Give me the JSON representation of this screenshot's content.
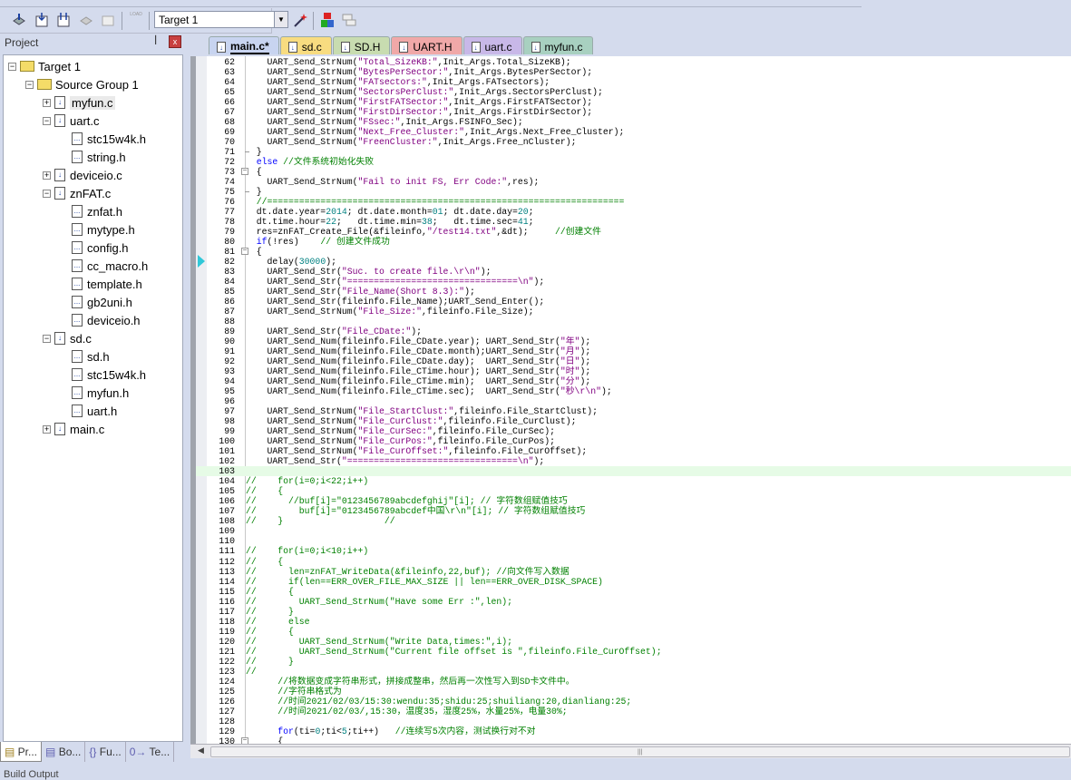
{
  "toolbar": {
    "target_select": "Target 1",
    "icons": [
      "translate-icon",
      "build-icon",
      "rebuild-icon",
      "batch-build-icon",
      "stop-build-icon",
      "download-icon",
      "target-options-icon",
      "manage-components-icon",
      "select-packs-icon"
    ],
    "load_label": "LOAD"
  },
  "project_panel": {
    "title": "Project",
    "tree": [
      {
        "label": "Target 1",
        "depth": 0,
        "kind": "target",
        "expander": "-"
      },
      {
        "label": "Source Group 1",
        "depth": 1,
        "kind": "group",
        "expander": "-"
      },
      {
        "label": "myfun.c",
        "depth": 2,
        "kind": "c",
        "expander": "+",
        "selected": true
      },
      {
        "label": "uart.c",
        "depth": 2,
        "kind": "c",
        "expander": "-"
      },
      {
        "label": "stc15w4k.h",
        "depth": 3,
        "kind": "h"
      },
      {
        "label": "string.h",
        "depth": 3,
        "kind": "h"
      },
      {
        "label": "deviceio.c",
        "depth": 2,
        "kind": "c",
        "expander": "+"
      },
      {
        "label": "znFAT.c",
        "depth": 2,
        "kind": "c",
        "expander": "-"
      },
      {
        "label": "znfat.h",
        "depth": 3,
        "kind": "h"
      },
      {
        "label": "mytype.h",
        "depth": 3,
        "kind": "h"
      },
      {
        "label": "config.h",
        "depth": 3,
        "kind": "h"
      },
      {
        "label": "cc_macro.h",
        "depth": 3,
        "kind": "h"
      },
      {
        "label": "template.h",
        "depth": 3,
        "kind": "h"
      },
      {
        "label": "gb2uni.h",
        "depth": 3,
        "kind": "h"
      },
      {
        "label": "deviceio.h",
        "depth": 3,
        "kind": "h"
      },
      {
        "label": "sd.c",
        "depth": 2,
        "kind": "c",
        "expander": "-"
      },
      {
        "label": "sd.h",
        "depth": 3,
        "kind": "h"
      },
      {
        "label": "stc15w4k.h",
        "depth": 3,
        "kind": "h"
      },
      {
        "label": "myfun.h",
        "depth": 3,
        "kind": "h"
      },
      {
        "label": "uart.h",
        "depth": 3,
        "kind": "h"
      },
      {
        "label": "main.c",
        "depth": 2,
        "kind": "c",
        "expander": "+"
      }
    ],
    "bottom_tabs": [
      {
        "label": "Pr...",
        "icon": "project-icon",
        "active": true
      },
      {
        "label": "Bo...",
        "icon": "books-icon"
      },
      {
        "label": "Fu...",
        "icon": "functions-icon",
        "glyph": "{}"
      },
      {
        "label": "Te...",
        "icon": "templates-icon",
        "glyph": "0→"
      }
    ]
  },
  "build_output_label": "Build Output",
  "editor": {
    "tabs": [
      {
        "label": "main.c*",
        "color": "#c8d4f0",
        "active": true
      },
      {
        "label": "sd.c",
        "color": "#f8dc80"
      },
      {
        "label": "SD.H",
        "color": "#c8dcb0"
      },
      {
        "label": "UART.H",
        "color": "#f0a8a8"
      },
      {
        "label": "uart.c",
        "color": "#c8b8e8"
      },
      {
        "label": "myfun.c",
        "color": "#a8d0c0"
      }
    ],
    "current_line": 82,
    "highlight_line": 103,
    "first_line": 62,
    "fold_open_lines": [
      73,
      81,
      130
    ],
    "fold_end_lines": [
      71,
      75
    ],
    "lines": [
      [
        [
          "p",
          "    UART_Send_StrNum("
        ],
        [
          "s",
          "\"Total_SizeKB:\""
        ],
        [
          "p",
          ",Init_Args.Total_SizeKB);"
        ]
      ],
      [
        [
          "p",
          "    UART_Send_StrNum("
        ],
        [
          "s",
          "\"BytesPerSector:\""
        ],
        [
          "p",
          ",Init_Args.BytesPerSector);"
        ]
      ],
      [
        [
          "p",
          "    UART_Send_StrNum("
        ],
        [
          "s",
          "\"FATsectors:\""
        ],
        [
          "p",
          ",Init_Args.FATsectors);"
        ]
      ],
      [
        [
          "p",
          "    UART_Send_StrNum("
        ],
        [
          "s",
          "\"SectorsPerClust:\""
        ],
        [
          "p",
          ",Init_Args.SectorsPerClust);"
        ]
      ],
      [
        [
          "p",
          "    UART_Send_StrNum("
        ],
        [
          "s",
          "\"FirstFATSector:\""
        ],
        [
          "p",
          ",Init_Args.FirstFATSector);"
        ]
      ],
      [
        [
          "p",
          "    UART_Send_StrNum("
        ],
        [
          "s",
          "\"FirstDirSector:\""
        ],
        [
          "p",
          ",Init_Args.FirstDirSector);"
        ]
      ],
      [
        [
          "p",
          "    UART_Send_StrNum("
        ],
        [
          "s",
          "\"FSsec:\""
        ],
        [
          "p",
          ",Init_Args.FSINFO_Sec);"
        ]
      ],
      [
        [
          "p",
          "    UART_Send_StrNum("
        ],
        [
          "s",
          "\"Next_Free_Cluster:\""
        ],
        [
          "p",
          ",Init_Args.Next_Free_Cluster);"
        ]
      ],
      [
        [
          "p",
          "    UART_Send_StrNum("
        ],
        [
          "s",
          "\"FreenCluster:\""
        ],
        [
          "p",
          ",Init_Args.Free_nCluster);"
        ]
      ],
      [
        [
          "p",
          "  }"
        ]
      ],
      [
        [
          "k",
          "  else"
        ],
        [
          "c",
          " //文件系统初始化失败"
        ]
      ],
      [
        [
          "p",
          "  {"
        ]
      ],
      [
        [
          "p",
          "    UART_Send_StrNum("
        ],
        [
          "s",
          "\"Fail to init FS, Err Code:\""
        ],
        [
          "p",
          ",res);"
        ]
      ],
      [
        [
          "p",
          "  }"
        ]
      ],
      [
        [
          "c",
          "  //==================================================================="
        ]
      ],
      [
        [
          "p",
          "  dt.date.year="
        ],
        [
          "n",
          "2014"
        ],
        [
          "p",
          "; dt.date.month="
        ],
        [
          "n",
          "01"
        ],
        [
          "p",
          "; dt.date.day="
        ],
        [
          "n",
          "20"
        ],
        [
          "p",
          ";"
        ]
      ],
      [
        [
          "p",
          "  dt.time.hour="
        ],
        [
          "n",
          "22"
        ],
        [
          "p",
          ";   dt.time.min="
        ],
        [
          "n",
          "38"
        ],
        [
          "p",
          ";   dt.time.sec="
        ],
        [
          "n",
          "41"
        ],
        [
          "p",
          ";"
        ]
      ],
      [
        [
          "p",
          "  res=znFAT_Create_File(&fileinfo,"
        ],
        [
          "s",
          "\"/test14.txt\""
        ],
        [
          "p",
          ",&dt);     "
        ],
        [
          "c",
          "//创建文件"
        ]
      ],
      [
        [
          "k",
          "  if"
        ],
        [
          "p",
          "(!res)    "
        ],
        [
          "c",
          "// 创建文件成功"
        ]
      ],
      [
        [
          "p",
          "  {"
        ]
      ],
      [
        [
          "p",
          "    delay("
        ],
        [
          "n",
          "30000"
        ],
        [
          "p",
          ");"
        ]
      ],
      [
        [
          "p",
          "    UART_Send_Str("
        ],
        [
          "s",
          "\"Suc. to create file.\\r\\n\""
        ],
        [
          "p",
          ");"
        ]
      ],
      [
        [
          "p",
          "    UART_Send_Str("
        ],
        [
          "s",
          "\"================================\\n\""
        ],
        [
          "p",
          ");"
        ]
      ],
      [
        [
          "p",
          "    UART_Send_Str("
        ],
        [
          "s",
          "\"File_Name(Short 8.3):\""
        ],
        [
          "p",
          ");"
        ]
      ],
      [
        [
          "p",
          "    UART_Send_Str(fileinfo.File_Name);UART_Send_Enter();"
        ]
      ],
      [
        [
          "p",
          "    UART_Send_StrNum("
        ],
        [
          "s",
          "\"File_Size:\""
        ],
        [
          "p",
          ",fileinfo.File_Size);"
        ]
      ],
      [
        [
          "p",
          ""
        ]
      ],
      [
        [
          "p",
          "    UART_Send_Str("
        ],
        [
          "s",
          "\"File_CDate:\""
        ],
        [
          "p",
          ");"
        ]
      ],
      [
        [
          "p",
          "    UART_Send_Num(fileinfo.File_CDate.year); UART_Send_Str("
        ],
        [
          "s",
          "\"年\""
        ],
        [
          "p",
          ");"
        ]
      ],
      [
        [
          "p",
          "    UART_Send_Num(fileinfo.File_CDate.month);UART_Send_Str("
        ],
        [
          "s",
          "\"月\""
        ],
        [
          "p",
          ");"
        ]
      ],
      [
        [
          "p",
          "    UART_Send_Num(fileinfo.File_CDate.day);  UART_Send_Str("
        ],
        [
          "s",
          "\"日\""
        ],
        [
          "p",
          ");"
        ]
      ],
      [
        [
          "p",
          "    UART_Send_Num(fileinfo.File_CTime.hour); UART_Send_Str("
        ],
        [
          "s",
          "\"时\""
        ],
        [
          "p",
          ");"
        ]
      ],
      [
        [
          "p",
          "    UART_Send_Num(fileinfo.File_CTime.min);  UART_Send_Str("
        ],
        [
          "s",
          "\"分\""
        ],
        [
          "p",
          ");"
        ]
      ],
      [
        [
          "p",
          "    UART_Send_Num(fileinfo.File_CTime.sec);  UART_Send_Str("
        ],
        [
          "s",
          "\"秒\\r\\n\""
        ],
        [
          "p",
          ");"
        ]
      ],
      [
        [
          "p",
          ""
        ]
      ],
      [
        [
          "p",
          "    UART_Send_StrNum("
        ],
        [
          "s",
          "\"File_StartClust:\""
        ],
        [
          "p",
          ",fileinfo.File_StartClust);"
        ]
      ],
      [
        [
          "p",
          "    UART_Send_StrNum("
        ],
        [
          "s",
          "\"File_CurClust:\""
        ],
        [
          "p",
          ",fileinfo.File_CurClust);"
        ]
      ],
      [
        [
          "p",
          "    UART_Send_StrNum("
        ],
        [
          "s",
          "\"File_CurSec:\""
        ],
        [
          "p",
          ",fileinfo.File_CurSec);"
        ]
      ],
      [
        [
          "p",
          "    UART_Send_StrNum("
        ],
        [
          "s",
          "\"File_CurPos:\""
        ],
        [
          "p",
          ",fileinfo.File_CurPos);"
        ]
      ],
      [
        [
          "p",
          "    UART_Send_StrNum("
        ],
        [
          "s",
          "\"File_CurOffset:\""
        ],
        [
          "p",
          ",fileinfo.File_CurOffset);"
        ]
      ],
      [
        [
          "p",
          "    UART_Send_Str("
        ],
        [
          "s",
          "\"================================\\n\""
        ],
        [
          "p",
          ");"
        ]
      ],
      [
        [
          "p",
          ""
        ]
      ],
      [
        [
          "c",
          "//    for(i=0;i<22;i++)"
        ]
      ],
      [
        [
          "c",
          "//    {"
        ]
      ],
      [
        [
          "c",
          "//      //buf[i]=\"0123456789abcdefghij\"[i]; // 字符数组赋值技巧"
        ]
      ],
      [
        [
          "c",
          "//        buf[i]=\"0123456789abcdef中国\\r\\n\"[i]; // 字符数组赋值技巧"
        ]
      ],
      [
        [
          "c",
          "//    }                   //"
        ]
      ],
      [
        [
          "p",
          ""
        ]
      ],
      [
        [
          "p",
          ""
        ]
      ],
      [
        [
          "c",
          "//    for(i=0;i<10;i++)"
        ]
      ],
      [
        [
          "c",
          "//    {"
        ]
      ],
      [
        [
          "c",
          "//      len=znFAT_WriteData(&fileinfo,22,buf); //向文件写入数据"
        ]
      ],
      [
        [
          "c",
          "//      if(len==ERR_OVER_FILE_MAX_SIZE || len==ERR_OVER_DISK_SPACE)"
        ]
      ],
      [
        [
          "c",
          "//      {"
        ]
      ],
      [
        [
          "c",
          "//        UART_Send_StrNum(\"Have some Err :\",len);"
        ]
      ],
      [
        [
          "c",
          "//      }"
        ]
      ],
      [
        [
          "c",
          "//      else"
        ]
      ],
      [
        [
          "c",
          "//      {"
        ]
      ],
      [
        [
          "c",
          "//        UART_Send_StrNum(\"Write Data,times:\",i);"
        ]
      ],
      [
        [
          "c",
          "//        UART_Send_StrNum(\"Current file offset is \",fileinfo.File_CurOffset);"
        ]
      ],
      [
        [
          "c",
          "//      }"
        ]
      ],
      [
        [
          "c",
          "//"
        ]
      ],
      [
        [
          "c",
          "      //将数据变成字符串形式，拼接成整串，然后再一次性写入到SD卡文件中。"
        ]
      ],
      [
        [
          "c",
          "      //字符串格式为"
        ]
      ],
      [
        [
          "c",
          "      //时间2021/02/03/15:30:wendu:35;shidu:25;shuiliang:20,dianliang:25;"
        ]
      ],
      [
        [
          "c",
          "      //时间2021/02/03/,15:30，温度35，湿度25%，水量25%，电量30%;"
        ]
      ],
      [
        [
          "p",
          ""
        ]
      ],
      [
        [
          "k",
          "      for"
        ],
        [
          "p",
          "(ti="
        ],
        [
          "n",
          "0"
        ],
        [
          "p",
          ";ti<"
        ],
        [
          "n",
          "5"
        ],
        [
          "p",
          ";ti++)   "
        ],
        [
          "c",
          "//连续写5次内容，测试换行对不对"
        ]
      ],
      [
        [
          "p",
          "      {"
        ]
      ]
    ]
  },
  "colors": {
    "keyword": "#0000ff",
    "string": "#800080",
    "number": "#008080",
    "comment": "#008000",
    "current_line_bg": "#e6fbe6",
    "accent": "#d4dbed"
  }
}
